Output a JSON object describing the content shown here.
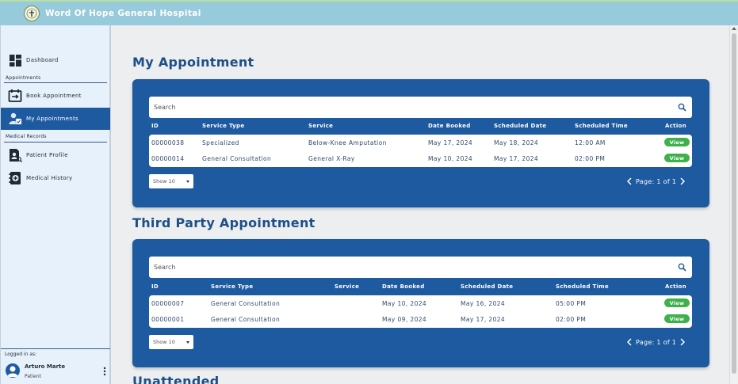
{
  "app": {
    "title": "Word Of Hope General Hospital"
  },
  "sidebar": {
    "dashboard": {
      "label": "Dashboard"
    },
    "appointments_section": "Appointments",
    "book_appointment": {
      "label": "Book Appointment"
    },
    "my_appointments": {
      "label": "My Appointments"
    },
    "medical_records_section": "Medical Records",
    "patient_profile": {
      "label": "Patient Profile"
    },
    "medical_history": {
      "label": "Medical History"
    },
    "footer": {
      "logged_in_label": "Logged in as:",
      "user_name": "Arturo Marte",
      "user_role": "Patient"
    }
  },
  "my_appointment": {
    "title": "My Appointment",
    "search_placeholder": "Search",
    "headers": [
      "ID",
      "Service Type",
      "Service",
      "Date Booked",
      "Scheduled Date",
      "Scheduled Time",
      "Action"
    ],
    "rows": [
      {
        "id": "00000038",
        "service_type": "Specialized",
        "service": "Below-Knee Amputation",
        "date_booked": "May 17, 2024",
        "scheduled_date": "May 18, 2024",
        "scheduled_time": "12:00 AM",
        "action": "View"
      },
      {
        "id": "00000014",
        "service_type": "General Consultation",
        "service": "General X-Ray",
        "date_booked": "May 10, 2024",
        "scheduled_date": "May 17, 2024",
        "scheduled_time": "02:00 PM",
        "action": "View"
      }
    ],
    "show_select": "Show 10",
    "page_label": "Page: 1 of 1"
  },
  "third_party": {
    "title": "Third Party Appointment",
    "search_placeholder": "Search",
    "headers": [
      "ID",
      "Service Type",
      "Service",
      "Date Booked",
      "Scheduled Date",
      "Scheduled Time",
      "Action"
    ],
    "rows": [
      {
        "id": "00000007",
        "service_type": "General Consultation",
        "service": "",
        "date_booked": "May 10, 2024",
        "scheduled_date": "May 16, 2024",
        "scheduled_time": "05:00 PM",
        "action": "View"
      },
      {
        "id": "00000001",
        "service_type": "General Consultation",
        "service": "",
        "date_booked": "May 09, 2024",
        "scheduled_date": "May 17, 2024",
        "scheduled_time": "02:00 PM",
        "action": "View"
      }
    ],
    "show_select": "Show 10",
    "page_label": "Page: 1 of 1"
  },
  "unattended": {
    "title": "Unattended"
  },
  "colors": {
    "primary": "#1e5aa0",
    "topbar": "#97cadb",
    "view_button": "#3fb14c",
    "title": "#1e4f86"
  },
  "icons": [
    "hospital-logo-icon",
    "dashboard-icon",
    "book-appointment-icon",
    "my-appointments-icon",
    "patient-profile-icon",
    "medical-history-icon",
    "search-icon",
    "chevron-left-icon",
    "chevron-right-icon",
    "user-avatar-icon",
    "kebab-menu-icon"
  ]
}
